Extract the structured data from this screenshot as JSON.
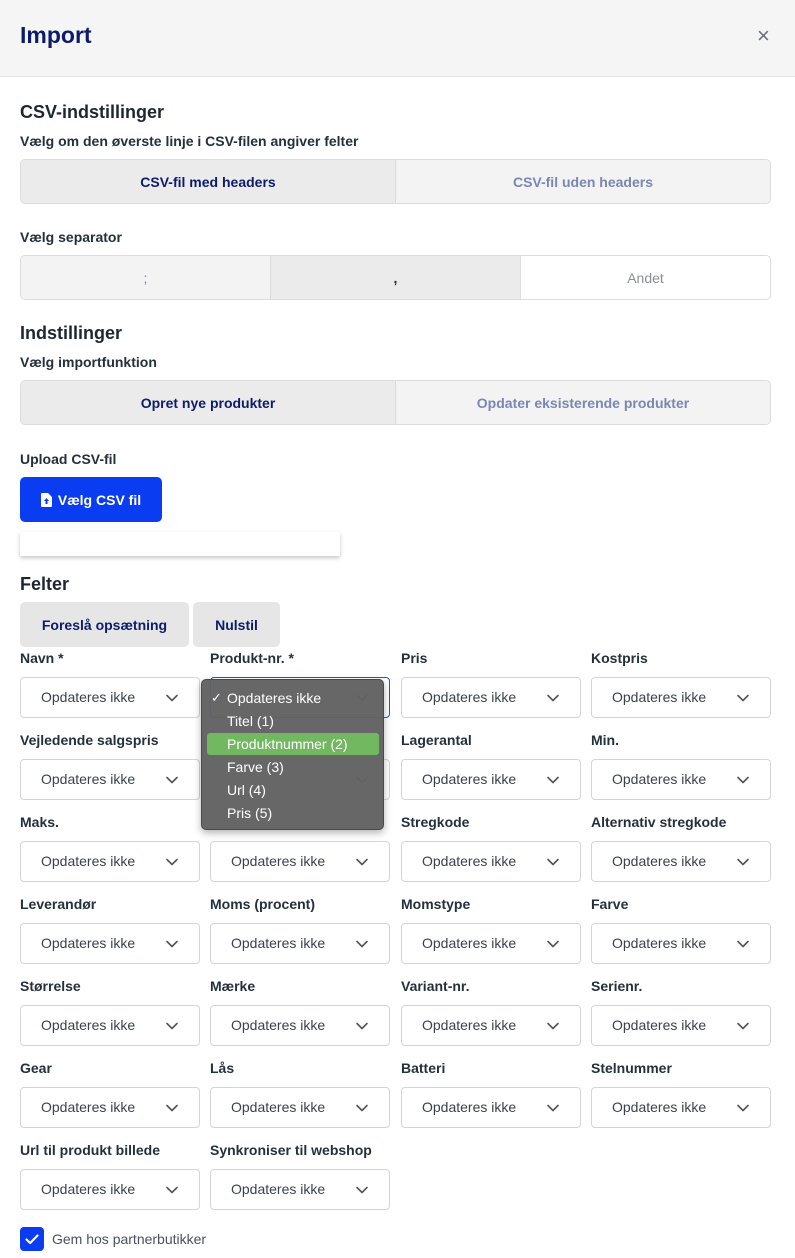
{
  "dialog": {
    "title": "Import",
    "close_icon": "×"
  },
  "csv": {
    "heading": "CSV-indstillinger",
    "header_label": "Vælg om den øverste linje i CSV-filen angiver felter",
    "header_options": [
      "CSV-fil med headers",
      "CSV-fil uden headers"
    ],
    "header_selected": "CSV-fil med headers",
    "separator_label": "Vælg separator",
    "separator_options": [
      ";",
      ",",
      "Andet"
    ],
    "separator_selected": ","
  },
  "settings": {
    "heading": "Indstillinger",
    "function_label": "Vælg importfunktion",
    "function_options": [
      "Opret nye produkter",
      "Opdater eksisterende produkter"
    ],
    "function_selected": "Opret nye produkter"
  },
  "upload": {
    "label": "Upload CSV-fil",
    "button_label": "Vælg CSV fil",
    "icon": "file-upload-icon"
  },
  "fields": {
    "heading": "Felter",
    "suggest_button": "Foreslå opsætning",
    "reset_button": "Nulstil",
    "select_default": "Opdateres ikke",
    "labels": [
      "Navn *",
      "Produkt-nr. *",
      "Pris",
      "Kostpris",
      "Vejledende salgspris",
      "",
      "Lagerantal",
      "Min.",
      "Maks.",
      "",
      "Stregkode",
      "Alternativ stregkode",
      "Leverandør",
      "Moms (procent)",
      "Momstype",
      "Farve",
      "Størrelse",
      "Mærke",
      "Variant-nr.",
      "Serienr.",
      "Gear",
      "Lås",
      "Batteri",
      "Stelnummer",
      "Url til produkt billede",
      "Synkroniser til webshop"
    ],
    "values": [
      "Opdateres ikke",
      "",
      "Opdateres ikke",
      "Opdateres ikke",
      "Opdateres ikke",
      "",
      "Opdateres ikke",
      "Opdateres ikke",
      "Opdateres ikke",
      "Opdateres ikke",
      "Opdateres ikke",
      "Opdateres ikke",
      "Opdateres ikke",
      "Opdateres ikke",
      "Opdateres ikke",
      "Opdateres ikke",
      "Opdateres ikke",
      "Opdateres ikke",
      "Opdateres ikke",
      "Opdateres ikke",
      "Opdateres ikke",
      "Opdateres ikke",
      "Opdateres ikke",
      "Opdateres ikke",
      "Opdateres ikke",
      "Opdateres ikke"
    ],
    "open_dropdown": {
      "for_field": "Produkt-nr. *",
      "options": [
        "Opdateres ikke",
        "Titel (1)",
        "Produktnummer (2)",
        "Farve (3)",
        "Url (4)",
        "Pris (5)"
      ],
      "checked": "Opdateres ikke",
      "highlighted": "Produktnummer (2)"
    }
  },
  "footer": {
    "checkbox_label": "Gem hos partnerbutikker",
    "checked": true
  },
  "colors": {
    "primary": "#0a3df2",
    "navy": "#0c1c6b",
    "highlight": "#72b860"
  }
}
